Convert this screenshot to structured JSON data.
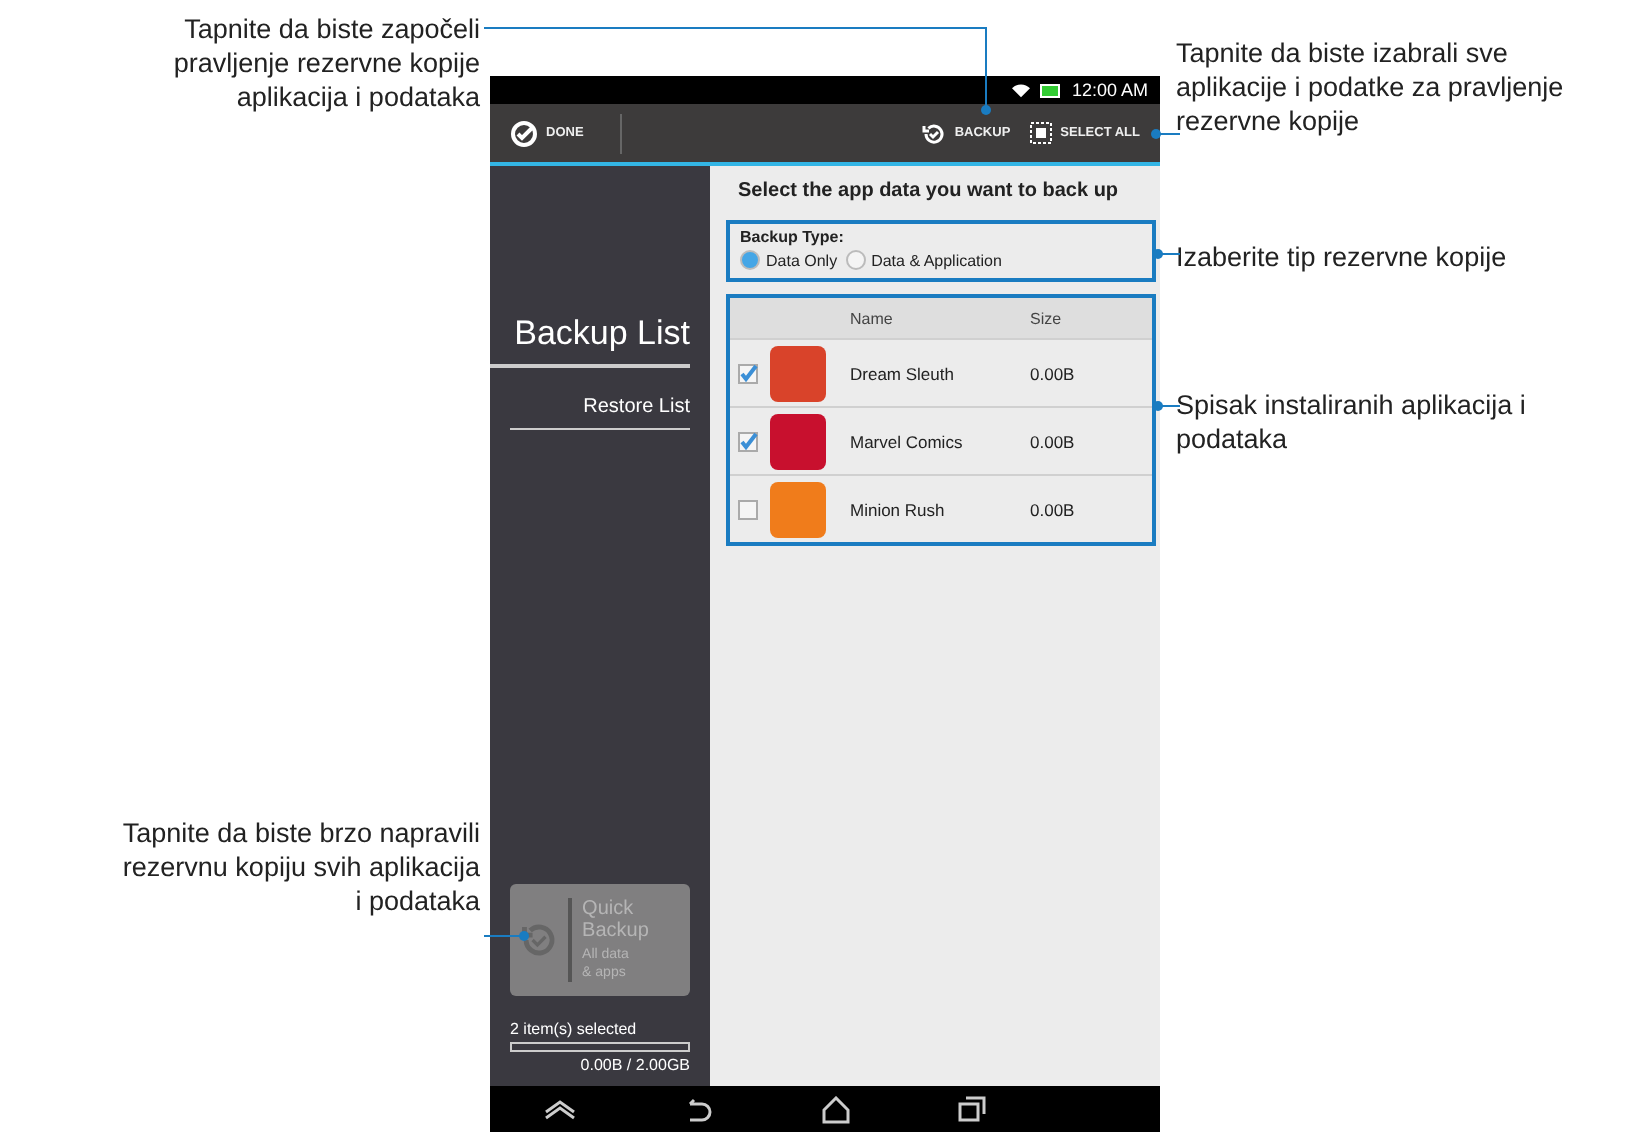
{
  "left_callouts": [
    "Tapnite da biste započeli pravljenje rezervne kopije aplikacija i podataka",
    "Tapnite da biste brzo napravili rezervnu kopiju svih aplikacija i podataka"
  ],
  "right_callouts": [
    "Tapnite da biste izabrali sve aplikacije i podatke za pravljenje rezervne kopije",
    "Izaberite tip rezervne kopije",
    "Spisak instaliranih aplikacija i podataka"
  ],
  "status_bar": {
    "time": "12:00 AM"
  },
  "action_bar": {
    "done": "DONE",
    "backup": "BACKUP",
    "select_all": "SELECT ALL"
  },
  "sidebar": {
    "items": [
      {
        "label": "Backup List",
        "selected": true
      },
      {
        "label": "Restore List",
        "selected": false
      }
    ],
    "quick_backup": {
      "title": "Quick Backup",
      "subtitle": "All data & apps"
    },
    "selection": "2 item(s) selected",
    "storage": {
      "reading": "0.00B / 2.00GB"
    }
  },
  "content": {
    "heading": "Select the app data you want to back up",
    "backup_type": {
      "label": "Backup Type:",
      "options": [
        {
          "label": "Data Only",
          "selected": true
        },
        {
          "label": "Data & Application",
          "selected": false
        }
      ]
    },
    "table": {
      "columns": [
        "Name",
        "Size"
      ],
      "rows": [
        {
          "name": "Dream Sleuth",
          "size": "0.00B",
          "checked": true,
          "color": "#d9432a"
        },
        {
          "name": "Marvel Comics",
          "size": "0.00B",
          "checked": true,
          "color": "#c8102e"
        },
        {
          "name": "Minion Rush",
          "size": "0.00B",
          "checked": false,
          "color": "#f07c1b"
        }
      ]
    }
  }
}
